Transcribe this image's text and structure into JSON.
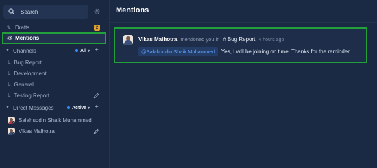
{
  "sidebar": {
    "search_placeholder": "Search",
    "drafts_label": "Drafts",
    "drafts_count": "2",
    "mentions_label": "Mentions",
    "channels": {
      "header": "Channels",
      "filter": "All",
      "items": [
        {
          "label": "Bug Report"
        },
        {
          "label": "Development"
        },
        {
          "label": "General"
        },
        {
          "label": "Testing Report"
        }
      ]
    },
    "direct_messages": {
      "header": "Direct Messages",
      "filter": "Active",
      "items": [
        {
          "label": "Salahuddin Shaik Muhammed"
        },
        {
          "label": "Vikas Malhotra"
        }
      ]
    }
  },
  "main": {
    "title": "Mentions",
    "mention": {
      "author": "Vikas Malhotra",
      "verb": "mentioned you in",
      "channel": "Bug Report",
      "time": "4 hours ago",
      "mention_tag": "@Salahuddin Shaik Muhammed",
      "message": "Yes, I will be joining on time. Thanks for the reminder"
    }
  },
  "colors": {
    "background": "#1b2a44",
    "highlight_border": "#22a03a",
    "mention_tag_text": "#5fa2ff",
    "badge": "#e2a12a"
  }
}
